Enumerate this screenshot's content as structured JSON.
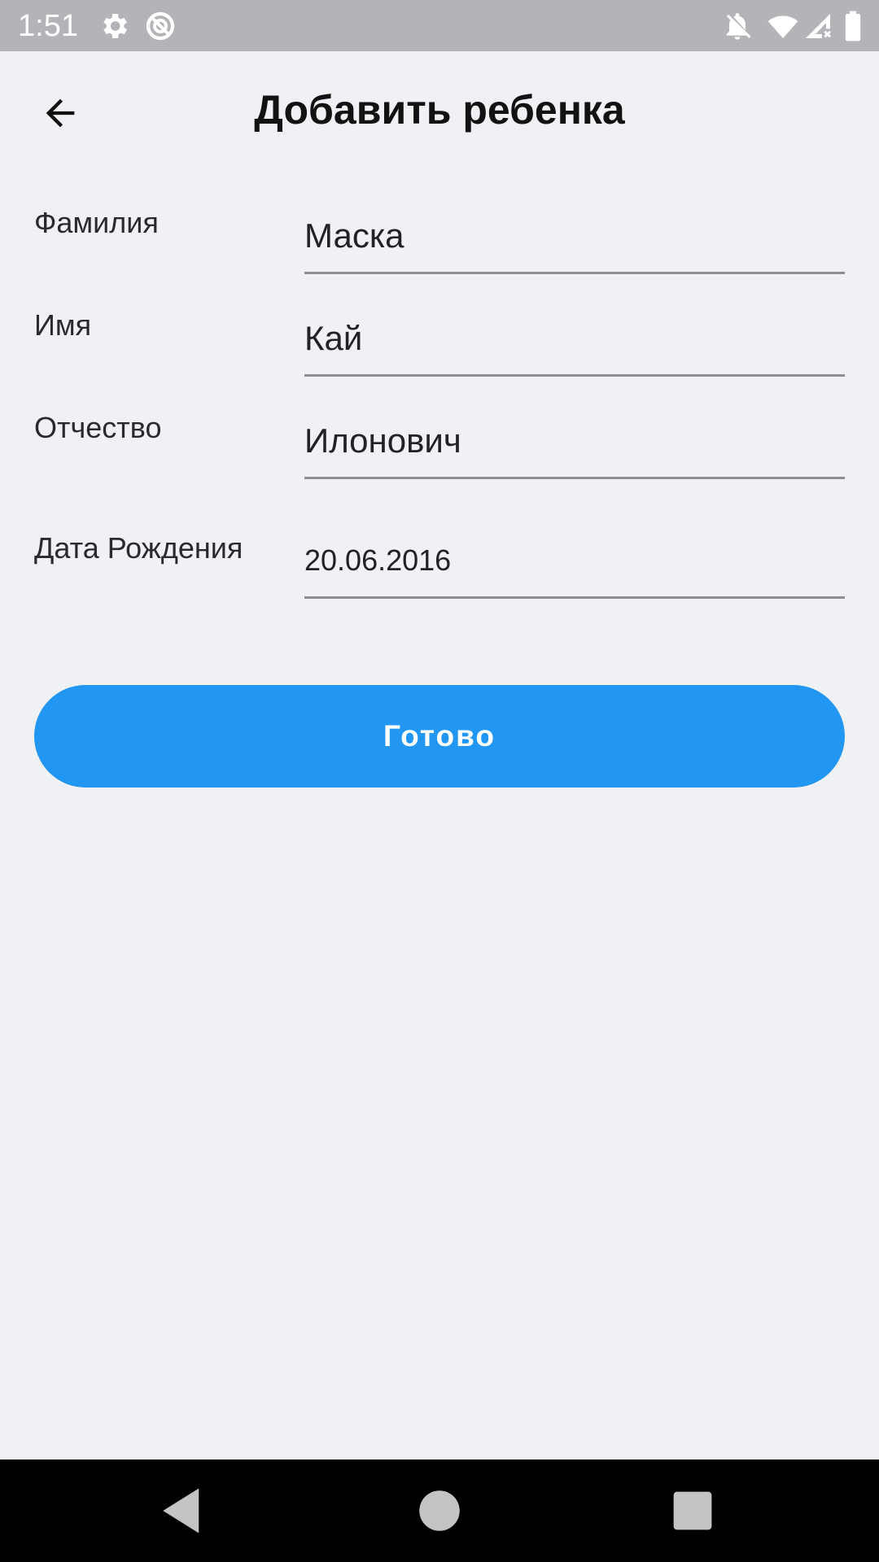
{
  "status_bar": {
    "time": "1:51",
    "icons": [
      "gear-icon",
      "data-saver-icon",
      "notifications-off-icon",
      "wifi-icon",
      "signal-icon",
      "battery-icon"
    ]
  },
  "header": {
    "title": "Добавить ребенка",
    "back_icon": "arrow-back-icon"
  },
  "form": {
    "last_name": {
      "label": "Фамилия",
      "value": "Маска"
    },
    "first_name": {
      "label": "Имя",
      "value": "Кай"
    },
    "patronymic": {
      "label": "Отчество",
      "value": "Илонович"
    },
    "birth_date": {
      "label": "Дата Рождения",
      "value": "20.06.2016"
    }
  },
  "actions": {
    "done_label": "Готово"
  },
  "nav_bar": {
    "icons": [
      "back-triangle-icon",
      "home-circle-icon",
      "recents-square-icon"
    ]
  },
  "colors": {
    "background": "#eff1f5",
    "status_bar": "#b3b4b8",
    "accent": "#2196f2",
    "underline": "#8d8e92"
  }
}
